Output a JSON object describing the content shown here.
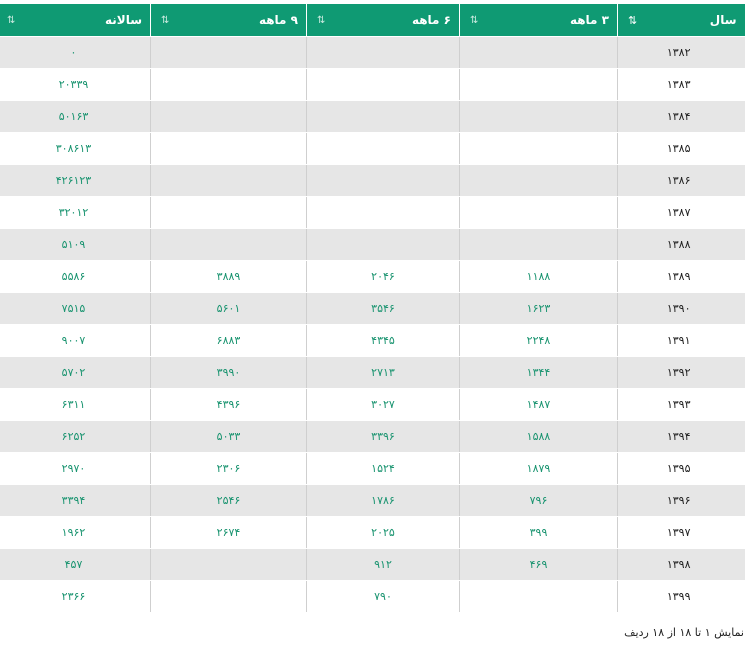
{
  "table": {
    "headers": {
      "year": "سال",
      "m3": "۳ ماهه",
      "m6": "۶ ماهه",
      "m9": "۹ ماهه",
      "yearly": "سالانه"
    },
    "rows": [
      {
        "year": "۱۳۸۲",
        "m3": "",
        "m6": "",
        "m9": "",
        "yearly": "۰"
      },
      {
        "year": "۱۳۸۳",
        "m3": "",
        "m6": "",
        "m9": "",
        "yearly": "۲۰۳۳۹"
      },
      {
        "year": "۱۳۸۴",
        "m3": "",
        "m6": "",
        "m9": "",
        "yearly": "۵۰۱۶۳"
      },
      {
        "year": "۱۳۸۵",
        "m3": "",
        "m6": "",
        "m9": "",
        "yearly": "۳۰۸۶۱۳"
      },
      {
        "year": "۱۳۸۶",
        "m3": "",
        "m6": "",
        "m9": "",
        "yearly": "۴۲۶۱۲۳"
      },
      {
        "year": "۱۳۸۷",
        "m3": "",
        "m6": "",
        "m9": "",
        "yearly": "۳۲۰۱۲"
      },
      {
        "year": "۱۳۸۸",
        "m3": "",
        "m6": "",
        "m9": "",
        "yearly": "۵۱۰۹"
      },
      {
        "year": "۱۳۸۹",
        "m3": "۱۱۸۸",
        "m6": "۲۰۴۶",
        "m9": "۳۸۸۹",
        "yearly": "۵۵۸۶"
      },
      {
        "year": "۱۳۹۰",
        "m3": "۱۶۲۳",
        "m6": "۳۵۴۶",
        "m9": "۵۶۰۱",
        "yearly": "۷۵۱۵"
      },
      {
        "year": "۱۳۹۱",
        "m3": "۲۲۴۸",
        "m6": "۴۳۴۵",
        "m9": "۶۸۸۳",
        "yearly": "۹۰۰۷"
      },
      {
        "year": "۱۳۹۲",
        "m3": "۱۳۴۴",
        "m6": "۲۷۱۳",
        "m9": "۳۹۹۰",
        "yearly": "۵۷۰۲"
      },
      {
        "year": "۱۳۹۳",
        "m3": "۱۴۸۷",
        "m6": "۳۰۲۷",
        "m9": "۴۳۹۶",
        "yearly": "۶۳۱۱"
      },
      {
        "year": "۱۳۹۴",
        "m3": "۱۵۸۸",
        "m6": "۳۳۹۶",
        "m9": "۵۰۳۳",
        "yearly": "۶۲۵۲"
      },
      {
        "year": "۱۳۹۵",
        "m3": "۱۸۷۹",
        "m6": "۱۵۲۴",
        "m9": "۲۳۰۶",
        "yearly": "۲۹۷۰"
      },
      {
        "year": "۱۳۹۶",
        "m3": "۷۹۶",
        "m6": "۱۷۸۶",
        "m9": "۲۵۴۶",
        "yearly": "۳۳۹۴"
      },
      {
        "year": "۱۳۹۷",
        "m3": "۳۹۹",
        "m6": "۲۰۲۵",
        "m9": "۲۶۷۴",
        "yearly": "۱۹۶۲"
      },
      {
        "year": "۱۳۹۸",
        "m3": "۴۶۹",
        "m6": "۹۱۲",
        "m9": "",
        "yearly": "۴۵۷"
      },
      {
        "year": "۱۳۹۹",
        "m3": "",
        "m6": "۷۹۰",
        "m9": "",
        "yearly": "۲۳۶۶"
      }
    ]
  },
  "footer": {
    "info": "نمایش ۱ تا ۱۸ از ۱۸ ردیف"
  },
  "colors": {
    "header_bg": "#0f9a73",
    "value_text": "#1a9470",
    "odd_row_bg": "#e6e6e6"
  },
  "icons": {
    "sort_active": "sort-amount-icon",
    "sort_inactive": "sort-arrows-icon"
  }
}
